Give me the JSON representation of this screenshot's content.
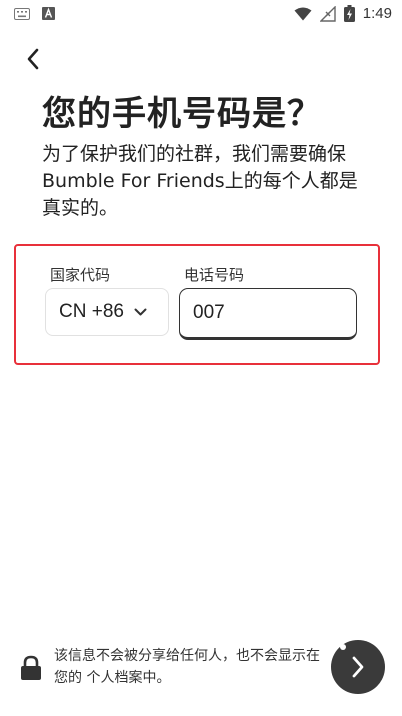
{
  "status_bar": {
    "time": "1:49",
    "left_icons": [
      "keyboard-icon",
      "a-notification-icon"
    ],
    "right_icons": [
      "wifi-icon",
      "no-signal-icon",
      "battery-charging-icon"
    ]
  },
  "header": {
    "back_icon": "chevron-left-icon"
  },
  "main": {
    "title": "您的手机号码是？",
    "subtitle": "为了保护我们的社群，我们需要确保Bumble For Friends上的每个人都是真实的。"
  },
  "form": {
    "country_label": "国家代码",
    "country_value": "CN +86",
    "phone_label": "电话号码",
    "phone_value": "007",
    "highlight_color": "#e8303a"
  },
  "footer": {
    "privacy_text": "该信息不会被分享给任何人，也不会显示在您的 个人档案中。",
    "next_icon": "chevron-right-icon",
    "button_color": "#3a3a3a"
  }
}
